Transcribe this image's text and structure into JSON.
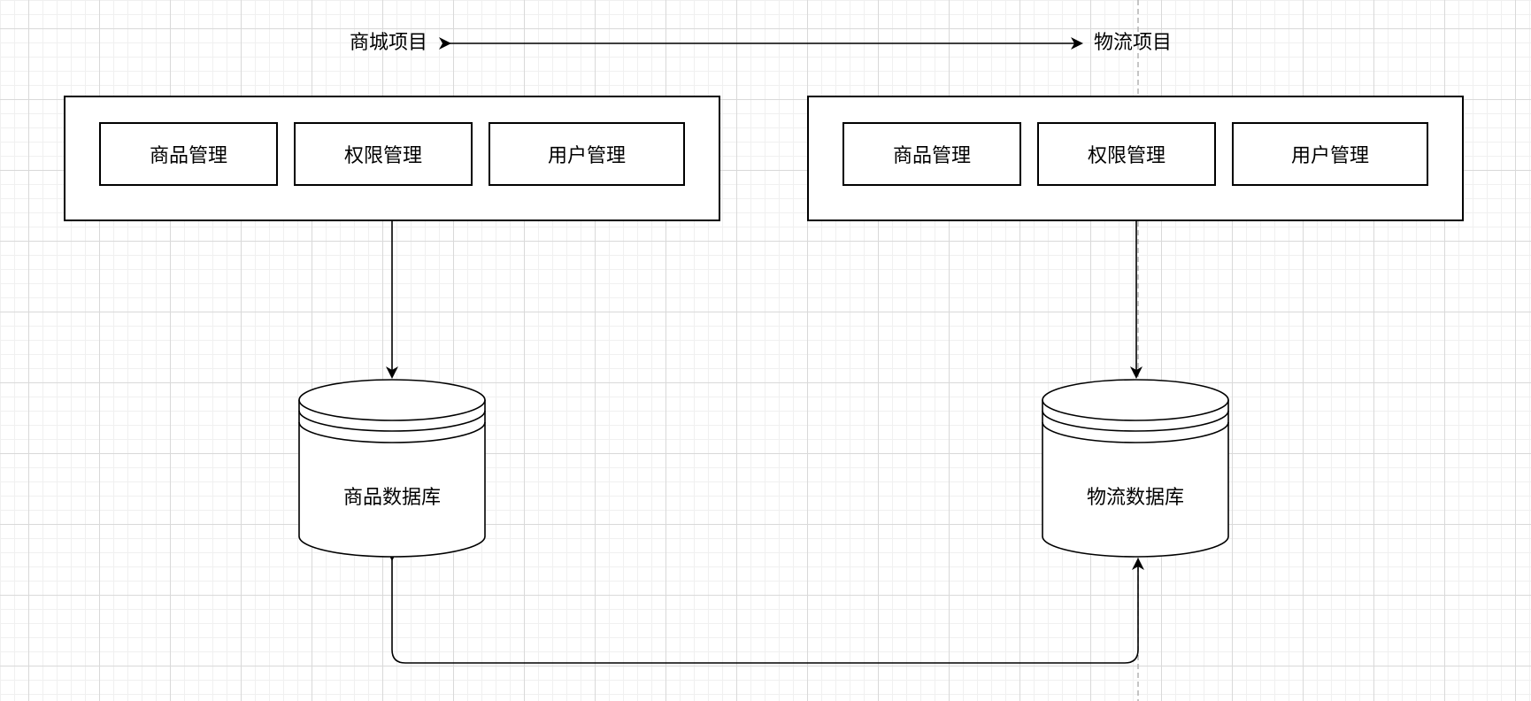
{
  "projects": {
    "mall": {
      "title": "商城项目",
      "modules": [
        "商品管理",
        "权限管理",
        "用户管理"
      ],
      "database": "商品数据库"
    },
    "logistics": {
      "title": "物流项目",
      "modules": [
        "商品管理",
        "权限管理",
        "用户管理"
      ],
      "database": "物流数据库"
    }
  },
  "colors": {
    "stroke": "#000000",
    "fill": "#ffffff",
    "grid": "#d9d9d9",
    "guide": "#b3b3b3"
  }
}
